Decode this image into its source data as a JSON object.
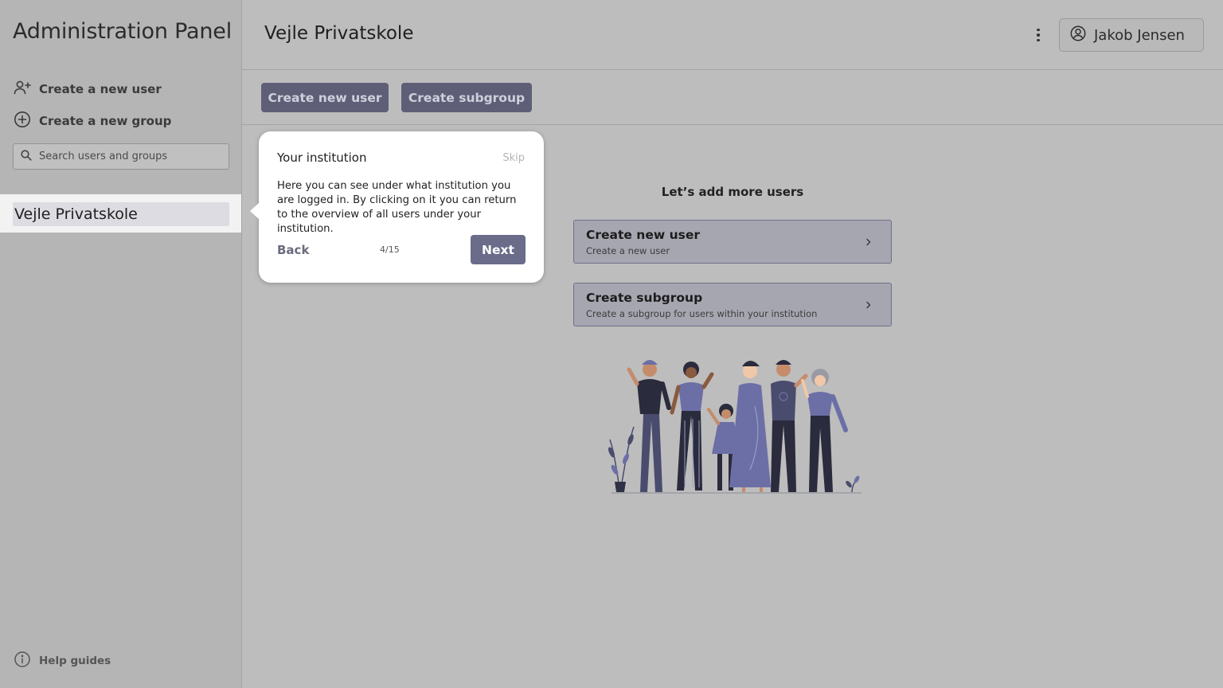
{
  "sidebar": {
    "app_title": "Administration Panel",
    "create_user_label": "Create a new user",
    "create_group_label": "Create a new group",
    "search_placeholder": "Search users and groups",
    "institution": "Vejle Privatskole",
    "help_label": "Help guides"
  },
  "header": {
    "title": "Vejle Privatskole",
    "user_name": "Jakob Jensen"
  },
  "toolbar": {
    "create_user_label": "Create new user",
    "create_subgroup_label": "Create subgroup"
  },
  "main": {
    "heading": "Let’s add more users",
    "cards": [
      {
        "title": "Create new user",
        "subtitle": "Create a new user"
      },
      {
        "title": "Create subgroup",
        "subtitle": "Create a subgroup for users within your institution"
      }
    ]
  },
  "tour": {
    "title": "Your institution",
    "skip_label": "Skip",
    "body": "Here you can see under what institution you are logged in. By clicking on it you can return to the overview of all users under your institution.",
    "back_label": "Back",
    "step": "4/15",
    "next_label": "Next"
  },
  "colors": {
    "primary_button": "#5e5f77",
    "tour_next": "#6a6c8a",
    "card_bg": "#a6a6b1",
    "overlay_bg": "#bdbdbd"
  },
  "icons": {
    "create_user": "person-add-icon",
    "create_group": "plus-circle-icon",
    "search": "search-icon",
    "help": "info-icon",
    "menu": "more-vertical-icon",
    "account": "account-circle-icon",
    "card_arrow": "chevron-right-icon"
  }
}
